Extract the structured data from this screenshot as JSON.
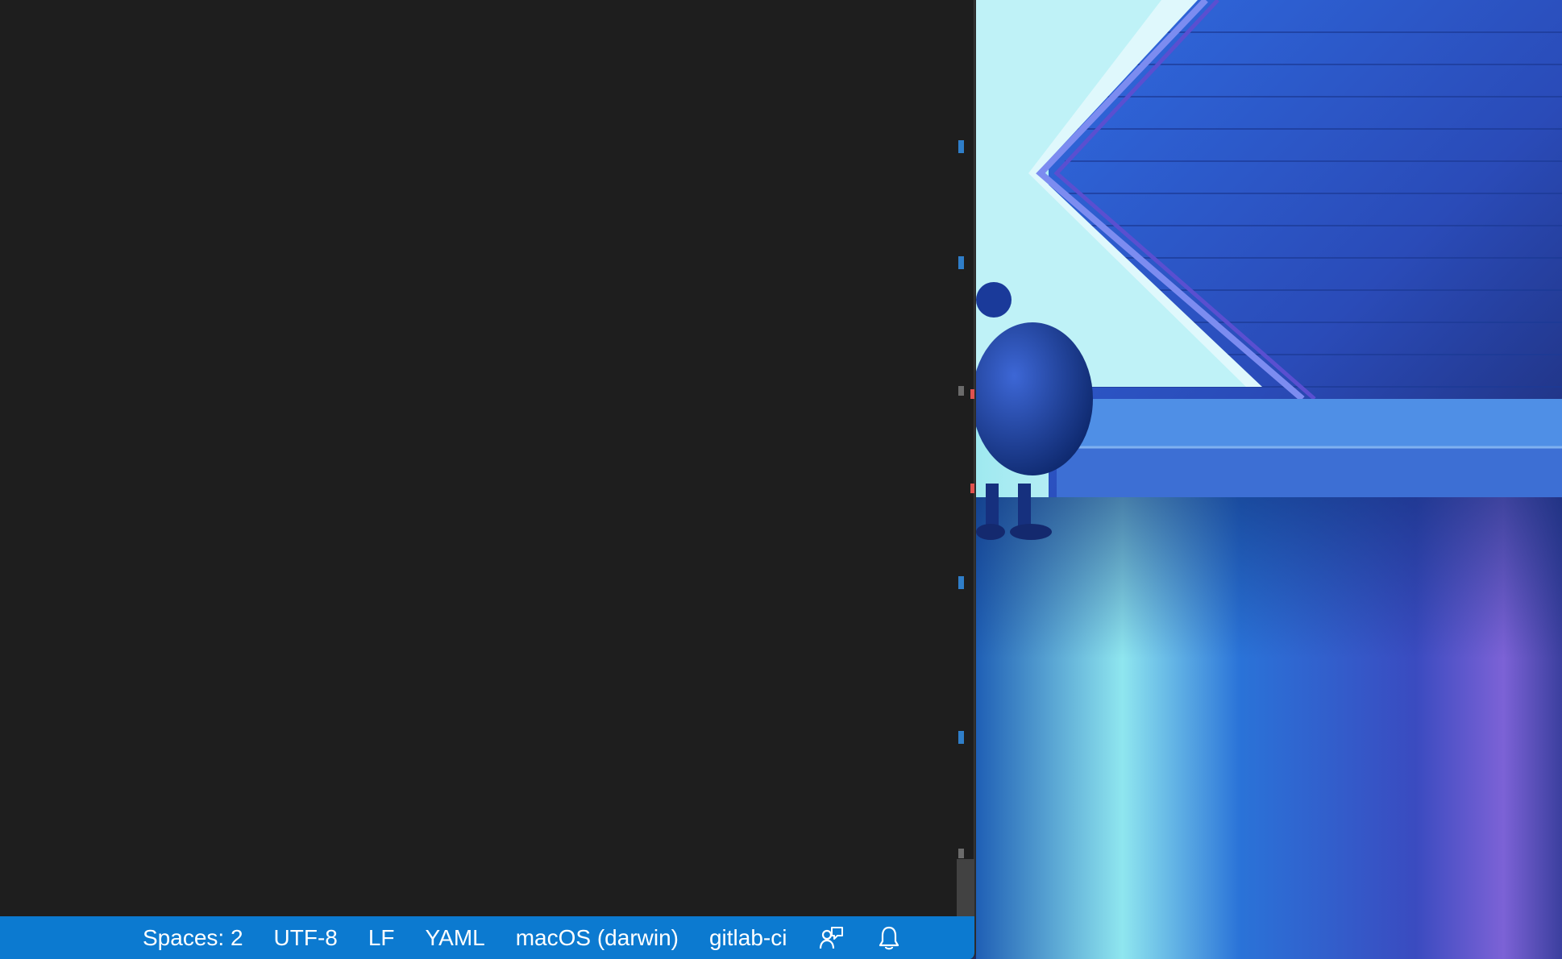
{
  "status_bar": {
    "items": [
      {
        "label": "Spaces: 2"
      },
      {
        "label": "UTF-8"
      },
      {
        "label": "LF"
      },
      {
        "label": "YAML"
      },
      {
        "label": "macOS (darwin)"
      },
      {
        "label": "gitlab-ci"
      }
    ],
    "icons": [
      "feedback-icon",
      "bell-icon"
    ],
    "background": "#0c7ad0",
    "text_color": "#ffffff"
  },
  "editor": {
    "background": "#1e1e1e",
    "ruler_marks": {
      "modified_color": "#2f7ec9",
      "error_color": "#e0524f",
      "neutral_color": "#6b6b6b"
    }
  },
  "desktop": {
    "wallpaper": "abstract-blue-neon-scene"
  }
}
